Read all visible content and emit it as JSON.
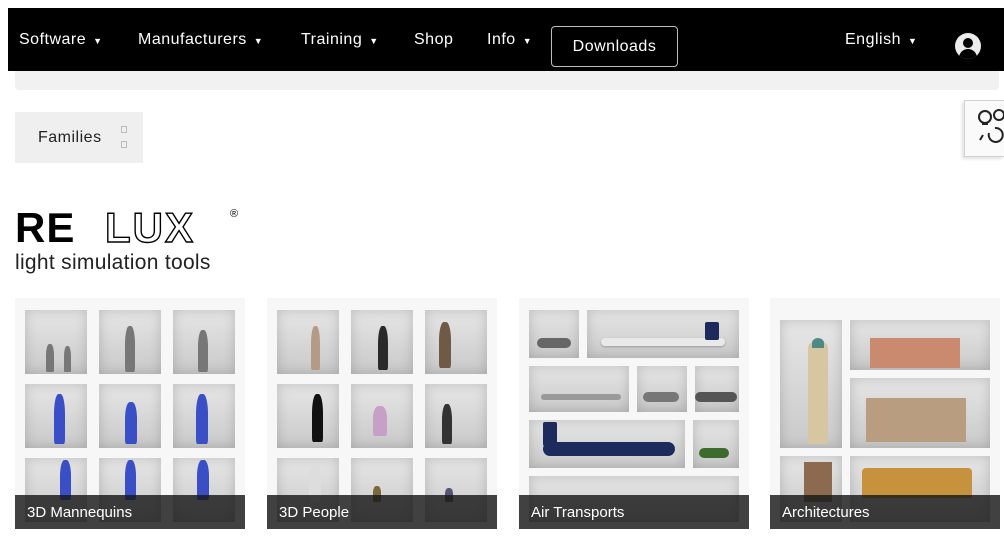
{
  "nav": {
    "items": [
      {
        "label": "Software",
        "caret": "▼"
      },
      {
        "label": "Manufacturers",
        "caret": "▼"
      },
      {
        "label": "Training",
        "caret": "▼"
      },
      {
        "label": "Shop",
        "caret": ""
      },
      {
        "label": "Info",
        "caret": "▼"
      }
    ],
    "downloads": "Downloads",
    "language": "English",
    "language_caret": "▼",
    "avatar_icon": "user-avatar-icon"
  },
  "filter": {
    "families_label": "Families"
  },
  "logo": {
    "word_bold": "RE",
    "word_outline": "LUX",
    "registered": "®",
    "tagline": "light simulation tools"
  },
  "categories": [
    {
      "label": "3D Mannequins"
    },
    {
      "label": "3D People"
    },
    {
      "label": "Air Transports"
    },
    {
      "label": "Architectures"
    }
  ],
  "colors": {
    "nav_bg": "#000000",
    "caption_bg": "#191919",
    "mannequin_blue": "#3a4fc6",
    "plane_navy": "#1c2a5c"
  }
}
